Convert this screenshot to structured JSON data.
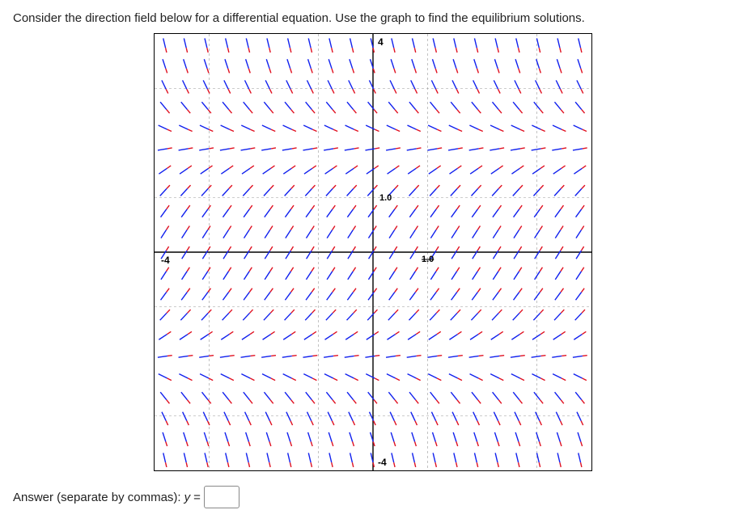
{
  "question": "Consider the direction field below for a differential equation. Use the graph to find the equilibrium solutions.",
  "graph": {
    "x_min": -4,
    "x_max": 4,
    "y_min": -4,
    "y_max": 4,
    "x_tick_label_left": "-4",
    "y_tick_label_top_small": "4",
    "tick_label_1_0": "1.0",
    "tick_label_lower": "-4",
    "equilibria": [
      2,
      -2
    ],
    "slope_fn_note": "slope ≈ -(y-2)(y+2) → positive between -2 and 2, negative outside"
  },
  "answer_label_prefix": "Answer (separate by commas):",
  "answer_variable": "y",
  "answer_equals": "=",
  "answer_value": ""
}
